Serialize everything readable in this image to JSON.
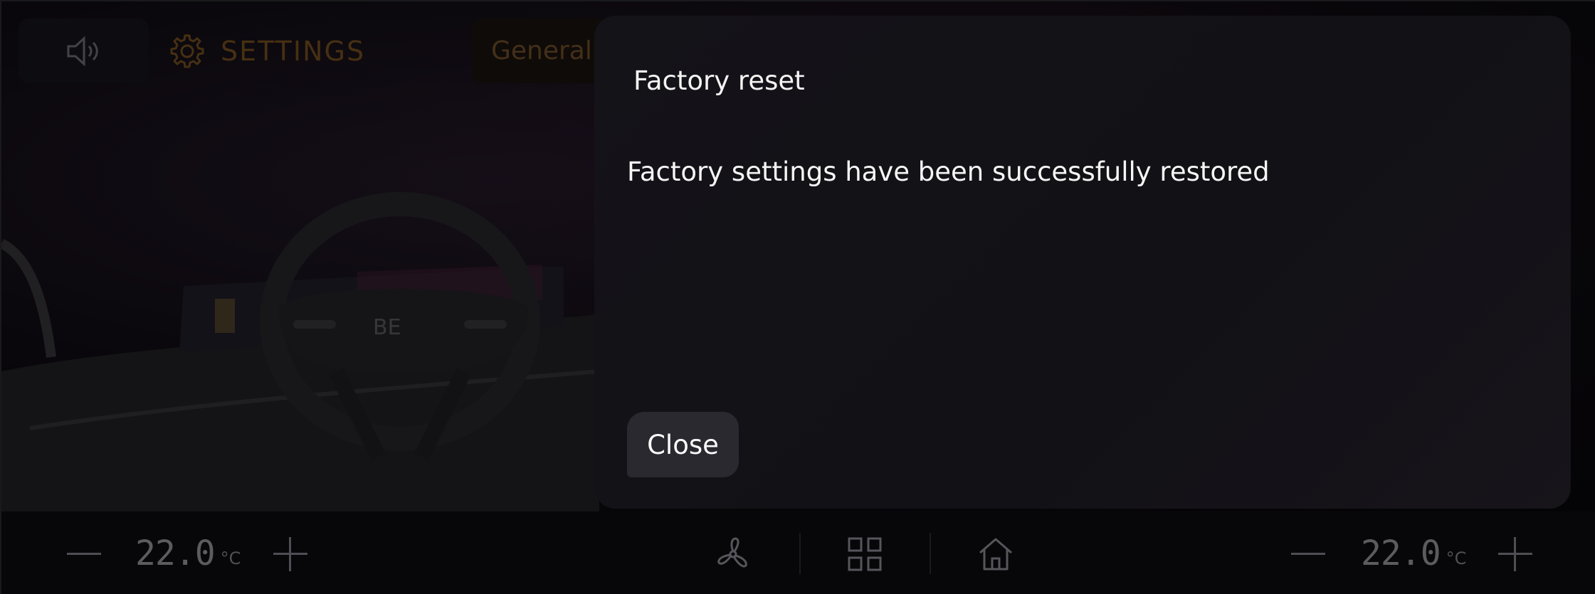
{
  "header": {
    "title": "SETTINGS",
    "tab": "General"
  },
  "dialog": {
    "title": "Factory reset",
    "message": "Factory settings have been successfully restored",
    "close_label": "Close"
  },
  "climate": {
    "left": {
      "value": "22.0",
      "unit": "°C"
    },
    "right": {
      "value": "22.0",
      "unit": "°C"
    }
  },
  "icons": {
    "volume": "volume-icon",
    "settings": "gear-icon",
    "fan": "fan-icon",
    "apps": "grid-icon",
    "home": "home-icon",
    "minus": "minus-icon",
    "plus": "plus-icon"
  },
  "colors": {
    "accent": "#5e4019",
    "dialog_bg": "#141318",
    "button_bg": "#2a2930"
  }
}
